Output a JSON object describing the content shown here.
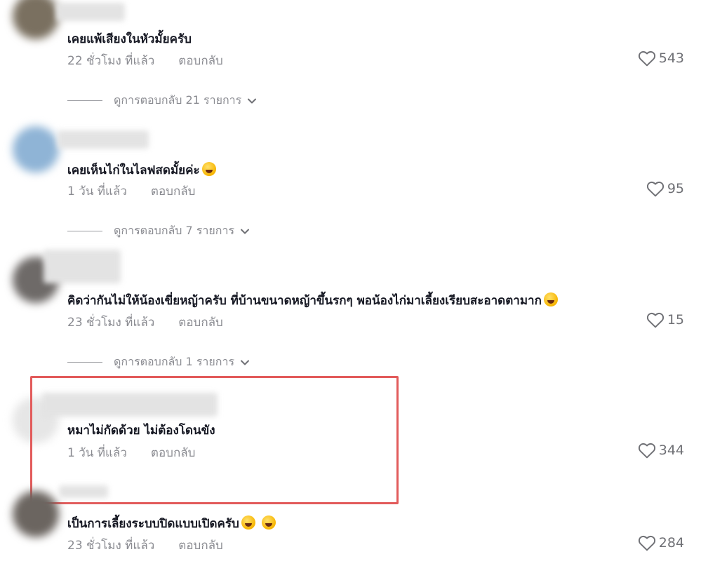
{
  "comments": [
    {
      "text": "เคยแพ้เสียงในหัวมั้ยครับ",
      "time": "22 ชั่วโมง ที่แล้ว",
      "reply_label": "ตอบกลับ",
      "likes": "543",
      "view_replies": "ดูการตอบกลับ 21 รายการ"
    },
    {
      "text": "เคยเห็นไก่ในไลฟสดมั้ยค่ะ",
      "time": "1 วัน ที่แล้ว",
      "reply_label": "ตอบกลับ",
      "likes": "95",
      "view_replies": "ดูการตอบกลับ 7 รายการ"
    },
    {
      "text": "คิดว่ากันไม่ให้น้องเขี่ยหญ้าครับ ที่บ้านขนาดหญ้าขึ้นรกๆ พอน้องไก่มาเลี้ยงเรียบสะอาดตามาก",
      "time": "23 ชั่วโมง ที่แล้ว",
      "reply_label": "ตอบกลับ",
      "likes": "15",
      "view_replies": "ดูการตอบกลับ 1 รายการ"
    },
    {
      "text": "หมาไม่กัดด้วย ไม่ต้องโดนขัง",
      "time": "1 วัน ที่แล้ว",
      "reply_label": "ตอบกลับ",
      "likes": "344"
    },
    {
      "text": "เป็นการเลี้ยงระบบปิดแบบเปิดครับ",
      "time": "23 ชั่วโมง ที่แล้ว",
      "reply_label": "ตอบกลับ",
      "likes": "284"
    }
  ],
  "icons": {
    "like": "heart-outline-icon",
    "expand": "chevron-down-icon",
    "emoji": "laughing-emoji-icon"
  },
  "colors": {
    "highlight_border": "#e25b5b",
    "muted_text": "#8a8b91"
  }
}
